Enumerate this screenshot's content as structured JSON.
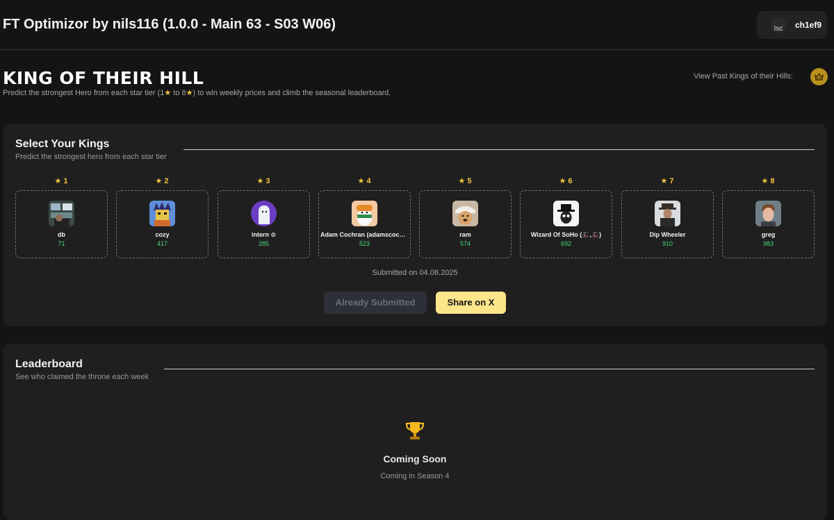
{
  "header": {
    "title": "FT Optimizor by nils116 (1.0.0 - Main 63 - S03 W06)",
    "user": {
      "name": "ch1ef9",
      "avatar_alt": "Isc"
    }
  },
  "hill": {
    "title": "KING OF THEIR HILL",
    "subtitle_pre": "Predict the strongest Hero from each star tier (1",
    "subtitle_mid": " to 8",
    "subtitle_post": ") to win weekly prices and climb the seasonal leaderboard.",
    "star_glyph": "★",
    "past_kings_label": "View Past Kings of their Hills:",
    "past_kings_icon": "crown-icon"
  },
  "kings": {
    "title": "Select Your Kings",
    "subtitle": "Predict the strongest hero from each star tier",
    "tiers": [
      {
        "stars": "★ 1",
        "name": "db",
        "score": "71",
        "avatar": "chart-thumb"
      },
      {
        "stars": "★ 2",
        "name": "cozy",
        "score": "417",
        "avatar": "pixel-cat"
      },
      {
        "stars": "★ 3",
        "name": "intern ⊙",
        "score": "285",
        "avatar": "ghost"
      },
      {
        "stars": "★ 4",
        "name": "Adam Cochran (adamscochran)",
        "score": "523",
        "avatar": "penguin"
      },
      {
        "stars": "★ 5",
        "name": "ram",
        "score": "574",
        "avatar": "dog"
      },
      {
        "stars": "★ 6",
        "name": "Wizard Of SoHo (🎩,🎩)",
        "score": "692",
        "avatar": "bw-hat"
      },
      {
        "stars": "★ 7",
        "name": "Dip Wheeler",
        "score": "910",
        "avatar": "man-hat"
      },
      {
        "stars": "★ 8",
        "name": "greg",
        "score": "983",
        "avatar": "man-face"
      }
    ],
    "submitted_text": "Submitted on 04.08.2025",
    "already_submitted_label": "Already Submitted",
    "share_label": "Share on X"
  },
  "leaderboard": {
    "title": "Leaderboard",
    "subtitle": "See who claimed the throne each week",
    "empty_icon": "trophy-icon",
    "empty_title": "Coming Soon",
    "empty_sub": "Coming in Season 4"
  },
  "colors": {
    "background": "#141414",
    "card": "#1f1f1f",
    "star": "#f5c542",
    "score": "#4ade80",
    "share_button": "#fde68a"
  }
}
